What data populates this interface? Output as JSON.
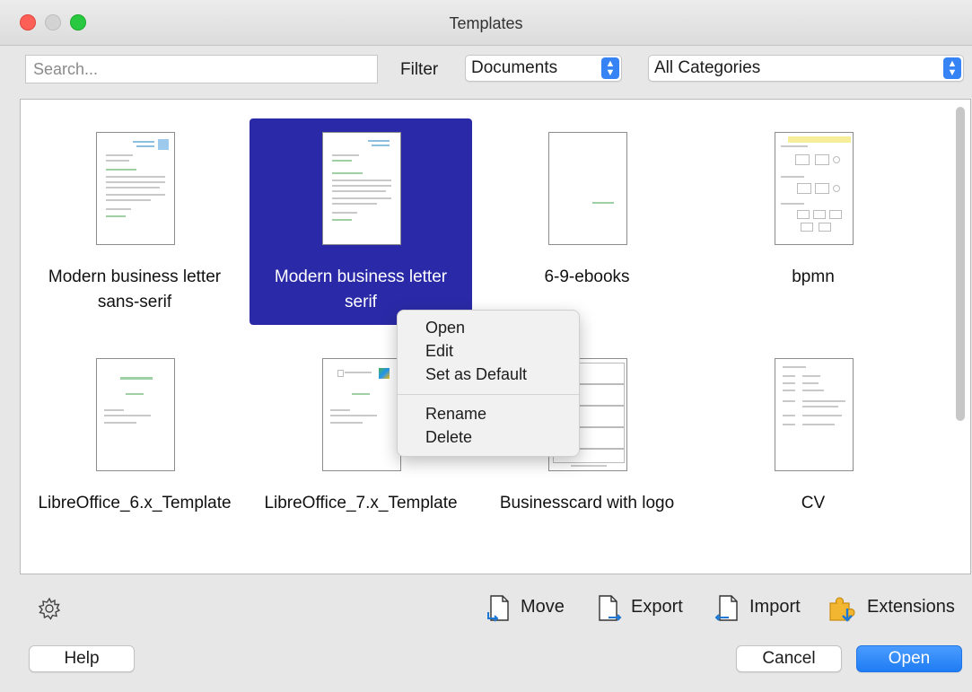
{
  "window": {
    "title": "Templates"
  },
  "toolbar": {
    "search_placeholder": "Search...",
    "filter_label": "Filter",
    "filter_value": "Documents",
    "category_value": "All Categories"
  },
  "templates": [
    {
      "name_line1": "Modern business letter",
      "name_line2": "sans-serif",
      "selected": false
    },
    {
      "name_line1": "Modern business letter",
      "name_line2": "serif",
      "selected": true
    },
    {
      "name_line1": "6-9-ebooks",
      "name_line2": "",
      "selected": false
    },
    {
      "name_line1": "bpmn",
      "name_line2": "",
      "selected": false
    },
    {
      "name_line1": "LibreOffice_6.x_Template",
      "name_line2": "",
      "selected": false
    },
    {
      "name_line1": "LibreOffice_7.x_Template",
      "name_line2": "",
      "selected": false
    },
    {
      "name_line1": "Businesscard with logo",
      "name_line2": "",
      "selected": false
    },
    {
      "name_line1": "CV",
      "name_line2": "",
      "selected": false
    }
  ],
  "context_menu": {
    "open": "Open",
    "edit": "Edit",
    "set_default": "Set as Default",
    "rename": "Rename",
    "delete": "Delete"
  },
  "actions": {
    "move": "Move",
    "export": "Export",
    "import": "Import",
    "extensions": "Extensions"
  },
  "footer": {
    "help": "Help",
    "cancel": "Cancel",
    "open": "Open"
  },
  "colors": {
    "selection": "#2a2aa8",
    "accent": "#1f7cf3"
  }
}
